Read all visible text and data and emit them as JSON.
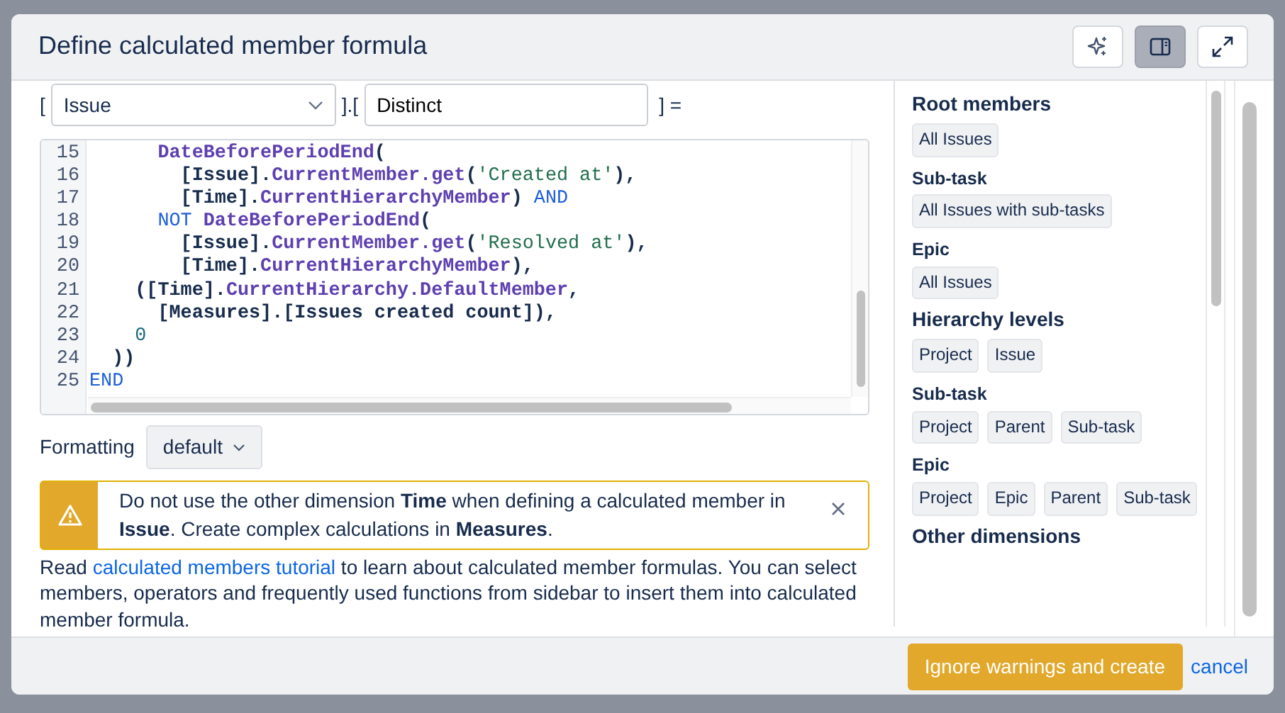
{
  "dialog": {
    "title": "Define calculated member formula",
    "header_buttons": [
      {
        "kind": "sparkle",
        "active": false
      },
      {
        "kind": "panel",
        "active": true
      },
      {
        "kind": "expand",
        "active": false
      }
    ]
  },
  "formula_name": {
    "open_bracket": "[",
    "dimension": "Issue",
    "separator": "].[",
    "name": "Distinct",
    "close": "] ="
  },
  "code": {
    "lines": [
      {
        "number": "15",
        "tokens": [
          {
            "text": "      DateBeforePeriodEnd",
            "kind": "function"
          },
          {
            "text": "(",
            "kind": "plain"
          }
        ]
      },
      {
        "number": "16",
        "tokens": [
          {
            "text": "        [Issue].",
            "kind": "plain"
          },
          {
            "text": "CurrentMember.get",
            "kind": "function"
          },
          {
            "text": "(",
            "kind": "plain"
          },
          {
            "text": "'Created at'",
            "kind": "string"
          },
          {
            "text": "),",
            "kind": "plain"
          }
        ]
      },
      {
        "number": "17",
        "tokens": [
          {
            "text": "        [Time].",
            "kind": "plain"
          },
          {
            "text": "CurrentHierarchyMember",
            "kind": "function"
          },
          {
            "text": ") ",
            "kind": "plain"
          },
          {
            "text": "AND",
            "kind": "keyword"
          }
        ]
      },
      {
        "number": "18",
        "tokens": [
          {
            "text": "      NOT",
            "kind": "keyword"
          },
          {
            "text": " DateBeforePeriodEnd",
            "kind": "function"
          },
          {
            "text": "(",
            "kind": "plain"
          }
        ]
      },
      {
        "number": "19",
        "tokens": [
          {
            "text": "        [Issue].",
            "kind": "plain"
          },
          {
            "text": "CurrentMember.get",
            "kind": "function"
          },
          {
            "text": "(",
            "kind": "plain"
          },
          {
            "text": "'Resolved at'",
            "kind": "string"
          },
          {
            "text": "),",
            "kind": "plain"
          }
        ]
      },
      {
        "number": "20",
        "tokens": [
          {
            "text": "        [Time].",
            "kind": "plain"
          },
          {
            "text": "CurrentHierarchyMember",
            "kind": "function"
          },
          {
            "text": "),",
            "kind": "plain"
          }
        ]
      },
      {
        "number": "21",
        "tokens": [
          {
            "text": "    ([Time].",
            "kind": "plain"
          },
          {
            "text": "CurrentHierarchy.DefaultMember",
            "kind": "function"
          },
          {
            "text": ",",
            "kind": "plain"
          }
        ]
      },
      {
        "number": "22",
        "tokens": [
          {
            "text": "      [Measures].[Issues created count]),",
            "kind": "plain"
          }
        ]
      },
      {
        "number": "23",
        "tokens": [
          {
            "text": "    0",
            "kind": "number"
          }
        ]
      },
      {
        "number": "24",
        "tokens": [
          {
            "text": "  ))",
            "kind": "plain"
          }
        ]
      },
      {
        "number": "25",
        "tokens": [
          {
            "text": "END",
            "kind": "keyword"
          }
        ]
      }
    ]
  },
  "formatting": {
    "label": "Formatting",
    "value": "default"
  },
  "warning": {
    "text": "Do not use the other dimension **Time** when defining a calculated member in **Issue**. Create complex calculations in **Measures**."
  },
  "help": {
    "before": "Read ",
    "link": "calculated members tutorial",
    "after": " to learn about calculated member formulas. You can select members, operators and frequently used functions from sidebar to insert them into calculated member formula."
  },
  "sidebar": {
    "sections": [
      {
        "kind": "group",
        "title": "Root members",
        "chips": [
          "All Issues"
        ]
      },
      {
        "kind": "subgroup",
        "title": "Sub-task",
        "chips": [
          "All Issues with sub-tasks"
        ]
      },
      {
        "kind": "subgroup",
        "title": "Epic",
        "chips": [
          "All Issues"
        ]
      },
      {
        "kind": "group",
        "title": "Hierarchy levels",
        "chips": [
          "Project",
          "Issue"
        ]
      },
      {
        "kind": "subgroup",
        "title": "Sub-task",
        "chips": [
          "Project",
          "Parent",
          "Sub-task"
        ]
      },
      {
        "kind": "subgroup",
        "title": "Epic",
        "chips": [
          "Project",
          "Epic",
          "Parent",
          "Sub-task"
        ]
      },
      {
        "kind": "group",
        "title": "Other dimensions"
      }
    ]
  },
  "footer": {
    "buttons": [
      {
        "kind": "primary",
        "label": "Ignore warnings and create"
      },
      {
        "kind": "link",
        "label": "cancel"
      }
    ]
  }
}
